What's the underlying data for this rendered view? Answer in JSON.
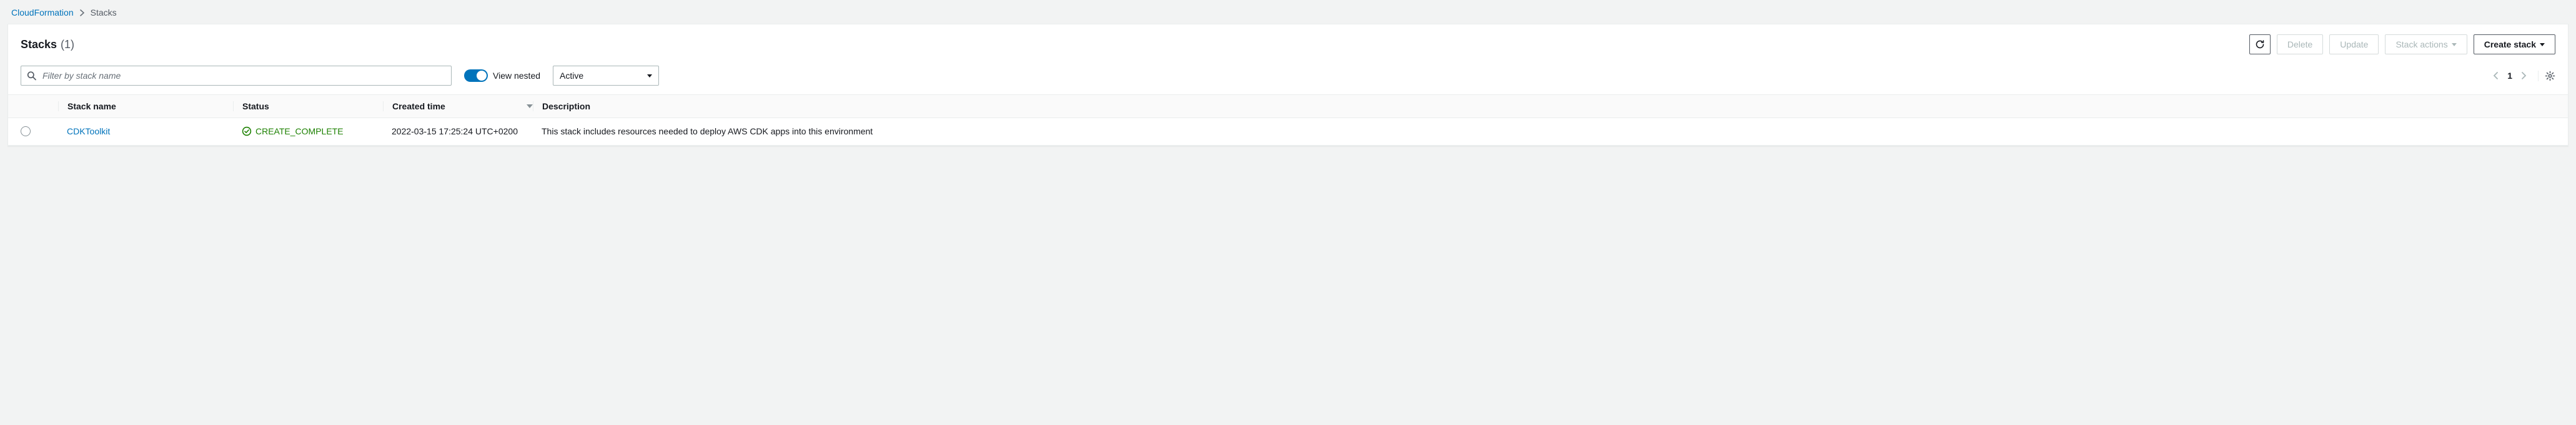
{
  "breadcrumb": {
    "root": "CloudFormation",
    "current": "Stacks"
  },
  "header": {
    "title": "Stacks",
    "count": "(1)"
  },
  "actions": {
    "delete": "Delete",
    "update": "Update",
    "stack_actions": "Stack actions",
    "create_stack": "Create stack"
  },
  "filters": {
    "search_placeholder": "Filter by stack name",
    "view_nested_label": "View nested",
    "status_selected": "Active"
  },
  "pagination": {
    "page": "1"
  },
  "columns": {
    "stack_name": "Stack name",
    "status": "Status",
    "created_time": "Created time",
    "description": "Description"
  },
  "rows": [
    {
      "stack_name": "CDKToolkit",
      "status": "CREATE_COMPLETE",
      "created_time": "2022-03-15 17:25:24 UTC+0200",
      "description": "This stack includes resources needed to deploy AWS CDK apps into this environment"
    }
  ]
}
